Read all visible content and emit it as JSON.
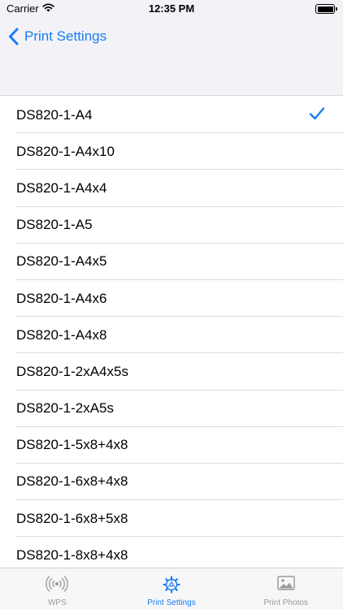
{
  "status_bar": {
    "carrier": "Carrier",
    "time": "12:35 PM"
  },
  "nav": {
    "back_label": "Print Settings"
  },
  "colors": {
    "accent": "#1a7cf5",
    "tab_inactive": "#999999",
    "bar_background": "#f2f2f7"
  },
  "settings_list": {
    "selected_index": 0,
    "items": [
      {
        "label": "DS820-1-A4",
        "checked": true
      },
      {
        "label": "DS820-1-A4x10",
        "checked": false
      },
      {
        "label": "DS820-1-A4x4",
        "checked": false
      },
      {
        "label": "DS820-1-A5",
        "checked": false
      },
      {
        "label": "DS820-1-A4x5",
        "checked": false
      },
      {
        "label": "DS820-1-A4x6",
        "checked": false
      },
      {
        "label": "DS820-1-A4x8",
        "checked": false
      },
      {
        "label": "DS820-1-2xA4x5s",
        "checked": false
      },
      {
        "label": "DS820-1-2xA5s",
        "checked": false
      },
      {
        "label": "DS820-1-5x8+4x8",
        "checked": false
      },
      {
        "label": "DS820-1-6x8+4x8",
        "checked": false
      },
      {
        "label": "DS820-1-6x8+5x8",
        "checked": false
      },
      {
        "label": "DS820-1-8x8+4x8",
        "checked": false
      }
    ]
  },
  "tab_bar": {
    "tabs": [
      {
        "label": "WPS",
        "icon": "wireless-signal-icon",
        "active": false
      },
      {
        "label": "Print Settings",
        "icon": "settings-gear-icon",
        "active": true
      },
      {
        "label": "Print Photos",
        "icon": "photo-icon",
        "active": false
      }
    ]
  }
}
